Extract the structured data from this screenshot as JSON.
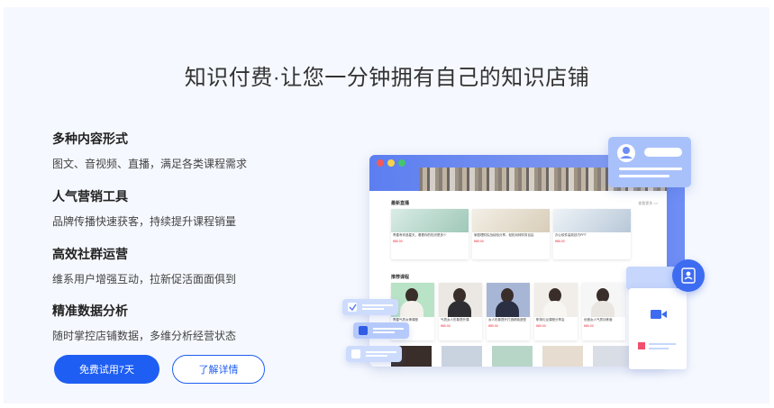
{
  "headline": "知识付费·让您一分钟拥有自己的知识店铺",
  "features": [
    {
      "title": "多种内容形式",
      "desc": "图文、音视频、直播，满足各类课程需求"
    },
    {
      "title": "人气营销工具",
      "desc": "品牌传播快速获客，持续提升课程销量"
    },
    {
      "title": "高效社群运营",
      "desc": "维系用户增强互动，拉新促活面面俱到"
    },
    {
      "title": "精准数据分析",
      "desc": "随时掌控店铺数据，多维分析经营状态"
    }
  ],
  "buttons": {
    "trial": "免费试用7天",
    "details": "了解详情"
  },
  "mockup": {
    "live_section": "最新直播",
    "course_section": "推荐课程",
    "more": "查看更多 >>",
    "live_cards": [
      {
        "title": "青春有你追星天，看看你的知识是多少",
        "price": "¥80.00"
      },
      {
        "title": "家庭理财实战经验分享，轻松玩转财务自由",
        "price": "¥80.00"
      },
      {
        "title": "办公软件高效技巧PPT",
        "price": "¥80.00"
      }
    ],
    "course_cards": [
      {
        "title": "青春气质女神课程",
        "price": "¥880.00"
      },
      {
        "title": "气质女人形象提升课",
        "price": "¥80.00"
      },
      {
        "title": "女人形象提升打造精致造型",
        "price": "¥80.00"
      },
      {
        "title": "职场礼仪课程分享会",
        "price": "¥80.00"
      },
      {
        "title": "优雅女人气质训练营",
        "price": "¥80.00"
      }
    ]
  },
  "colors": {
    "accent": "#1e5ef2",
    "panel_bg": "#f5f8fe",
    "illustration_blue": "#6f8ef5"
  }
}
